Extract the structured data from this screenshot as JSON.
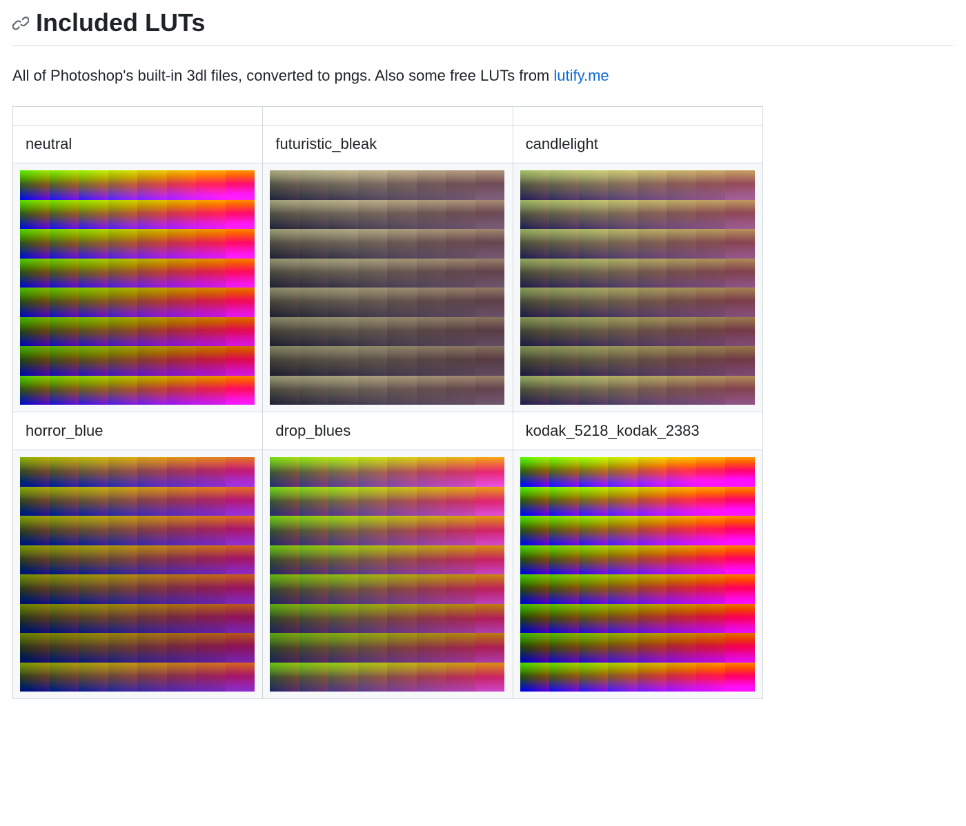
{
  "heading": "Included LUTs",
  "description": {
    "prefix": "All of Photoshop's built-in 3dl files, converted to pngs. Also some free LUTs from ",
    "link_text": "lutify.me",
    "link_href": "#"
  },
  "columns": 3,
  "luts": [
    {
      "name": "neutral",
      "class": "neutral"
    },
    {
      "name": "futuristic_bleak",
      "class": "futuristic_bleak"
    },
    {
      "name": "candlelight",
      "class": "candlelight"
    },
    {
      "name": "horror_blue",
      "class": "horror_blue"
    },
    {
      "name": "drop_blues",
      "class": "drop_blues"
    },
    {
      "name": "kodak_5218_kodak_2383",
      "class": "kodak_5218_kodak_2383"
    }
  ]
}
